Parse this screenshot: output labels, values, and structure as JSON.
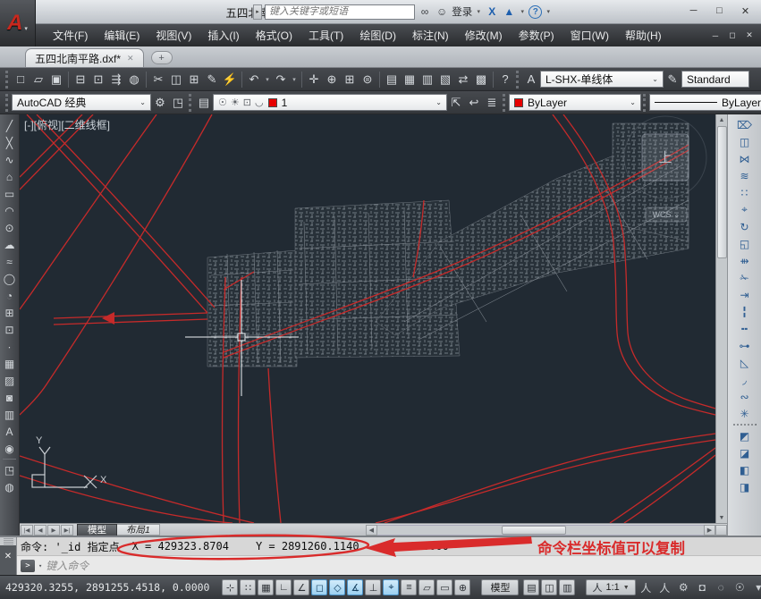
{
  "titlebar": {
    "title": "五四北南平路.dxf",
    "search_placeholder": "键入关键字或短语",
    "signin_label": "登录",
    "logo_letter": "A",
    "icons": [
      {
        "name": "search-icon",
        "glyph": "∞"
      },
      {
        "name": "user-icon",
        "glyph": "☺"
      }
    ],
    "right_icons": [
      {
        "name": "signin-dropdown-icon",
        "glyph": "▾"
      },
      {
        "name": "autodesk360-icon",
        "glyph": "X"
      },
      {
        "name": "exchange-apps-icon",
        "glyph": "▲"
      },
      {
        "name": "exchange-dropdown-icon",
        "glyph": "▾"
      }
    ],
    "help_glyph": "?",
    "help_dropdown_glyph": "▾",
    "controls": [
      {
        "name": "minimize-button",
        "glyph": "─"
      },
      {
        "name": "maximize-button",
        "glyph": "□"
      },
      {
        "name": "close-button",
        "glyph": "✕"
      }
    ]
  },
  "menubar": {
    "items": [
      {
        "name": "menu-file",
        "label": "文件(F)"
      },
      {
        "name": "menu-edit",
        "label": "编辑(E)"
      },
      {
        "name": "menu-view",
        "label": "视图(V)"
      },
      {
        "name": "menu-insert",
        "label": "插入(I)"
      },
      {
        "name": "menu-format",
        "label": "格式(O)"
      },
      {
        "name": "menu-tools",
        "label": "工具(T)"
      },
      {
        "name": "menu-draw",
        "label": "绘图(D)"
      },
      {
        "name": "menu-dimension",
        "label": "标注(N)"
      },
      {
        "name": "menu-modify",
        "label": "修改(M)"
      },
      {
        "name": "menu-parametric",
        "label": "参数(P)"
      },
      {
        "name": "menu-window",
        "label": "窗口(W)"
      },
      {
        "name": "menu-help",
        "label": "帮助(H)"
      }
    ],
    "controls": [
      {
        "name": "doc-minimize-button",
        "glyph": "─"
      },
      {
        "name": "doc-restore-button",
        "glyph": "◻"
      },
      {
        "name": "doc-close-button",
        "glyph": "✕"
      }
    ]
  },
  "tabbar": {
    "active_tab": "五四北南平路.dxf*",
    "close_glyph": "✕",
    "new_tab_glyph": "+"
  },
  "toolbar_std": {
    "icons": [
      {
        "name": "qnew-icon",
        "glyph": "□"
      },
      {
        "name": "open-icon",
        "glyph": "▱"
      },
      {
        "name": "save-icon",
        "glyph": "▣"
      },
      {
        "sep": true
      },
      {
        "name": "plot-icon",
        "glyph": "⊟"
      },
      {
        "name": "plot-preview-icon",
        "glyph": "⊡"
      },
      {
        "name": "publish-icon",
        "glyph": "⇶"
      },
      {
        "name": "export-dwf-icon",
        "glyph": "◍"
      },
      {
        "sep": true
      },
      {
        "name": "cut-icon",
        "glyph": "✂"
      },
      {
        "name": "copy-clip-icon",
        "glyph": "◫"
      },
      {
        "name": "paste-icon",
        "glyph": "⊞"
      },
      {
        "name": "match-properties-icon",
        "glyph": "✎"
      },
      {
        "name": "block-editor-icon",
        "glyph": "⚡"
      },
      {
        "sep": true
      },
      {
        "name": "undo-icon",
        "glyph": "↶"
      },
      {
        "name": "undo-dropdown-icon",
        "glyph": "▾",
        "small": true
      },
      {
        "name": "redo-icon",
        "glyph": "↷"
      },
      {
        "name": "redo-dropdown-icon",
        "glyph": "▾",
        "small": true
      },
      {
        "sep": true
      },
      {
        "name": "pan-icon",
        "glyph": "✛"
      },
      {
        "name": "zoom-realtime-icon",
        "glyph": "⊕"
      },
      {
        "name": "zoom-window-icon",
        "glyph": "⊞"
      },
      {
        "name": "zoom-previous-icon",
        "glyph": "⊜"
      },
      {
        "sep": true
      },
      {
        "name": "properties-icon",
        "glyph": "▤"
      },
      {
        "name": "designcenter-icon",
        "glyph": "▦"
      },
      {
        "name": "tool-palettes-icon",
        "glyph": "▥"
      },
      {
        "name": "sheet-set-manager-icon",
        "glyph": "▧"
      },
      {
        "name": "markup-set-manager-icon",
        "glyph": "⇄"
      },
      {
        "name": "quickcalc-icon",
        "glyph": "▩"
      },
      {
        "sep": true
      },
      {
        "name": "help-icon",
        "glyph": "?"
      }
    ]
  },
  "toolbar_styles": {
    "text_style_icon": "A",
    "text_style_value": "L-SHX-单线体",
    "dim_style_icon": "✎",
    "dim_style_value": "Standard",
    "caret": "⌄"
  },
  "toolbar_workspace": {
    "value": "AutoCAD 经典",
    "caret": "⌄",
    "icons": [
      {
        "name": "workspace-settings-icon",
        "glyph": "⚙"
      },
      {
        "name": "workspace-save-icon",
        "glyph": "◳"
      }
    ]
  },
  "toolbar_layers": {
    "layer_properties_icon": {
      "name": "layer-properties-icon",
      "glyph": "▤"
    },
    "state_icons": [
      {
        "name": "layer-on-bulb-icon",
        "glyph": "☉"
      },
      {
        "name": "layer-freeze-sun-icon",
        "glyph": "☀"
      },
      {
        "name": "layer-plot-icon",
        "glyph": "⊡"
      },
      {
        "name": "layer-unlock-icon",
        "glyph": "◡"
      }
    ],
    "current_layer": "1",
    "layer_swatch_color": "#e60000",
    "tool_icons": [
      {
        "name": "make-object-layer-current-icon",
        "glyph": "⇱"
      },
      {
        "name": "layer-previous-icon",
        "glyph": "↩"
      },
      {
        "name": "layer-states-icon",
        "glyph": "≣"
      }
    ],
    "color_value": "ByLayer",
    "linetype_value": "ByLayer",
    "caret": "⌄"
  },
  "draw_toolbar": {
    "icons": [
      {
        "name": "line-icon",
        "glyph": "╱"
      },
      {
        "name": "construction-line-icon",
        "glyph": "╳"
      },
      {
        "name": "polyline-icon",
        "glyph": "∿"
      },
      {
        "name": "polygon-icon",
        "glyph": "⌂"
      },
      {
        "name": "rectangle-icon",
        "glyph": "▭"
      },
      {
        "name": "arc-icon",
        "glyph": "◠"
      },
      {
        "name": "circle-icon",
        "glyph": "⊙"
      },
      {
        "name": "revision-cloud-icon",
        "glyph": "☁"
      },
      {
        "name": "spline-icon",
        "glyph": "≈"
      },
      {
        "name": "ellipse-icon",
        "glyph": "◯"
      },
      {
        "name": "ellipse-arc-icon",
        "glyph": "◔"
      },
      {
        "name": "insert-block-icon",
        "glyph": "⊞"
      },
      {
        "name": "create-block-icon",
        "glyph": "⊡"
      },
      {
        "name": "point-icon",
        "glyph": "∙"
      },
      {
        "name": "hatch-icon",
        "glyph": "▦"
      },
      {
        "name": "gradient-icon",
        "glyph": "▨"
      },
      {
        "name": "region-icon",
        "glyph": "◙"
      },
      {
        "name": "table-icon",
        "glyph": "▥"
      },
      {
        "name": "mtext-icon",
        "glyph": "A"
      },
      {
        "name": "add-selected-icon",
        "glyph": "◉"
      },
      {
        "sep": true
      },
      {
        "name": "viewports-icon",
        "glyph": "◳"
      },
      {
        "name": "navigation-sphere-icon",
        "glyph": "◍"
      }
    ]
  },
  "modify_toolbar": {
    "icons": [
      {
        "name": "erase-icon",
        "glyph": "⌦"
      },
      {
        "name": "copy-icon",
        "glyph": "◫"
      },
      {
        "name": "mirror-icon",
        "glyph": "⋈"
      },
      {
        "name": "offset-icon",
        "glyph": "≋"
      },
      {
        "name": "array-icon",
        "glyph": "∷"
      },
      {
        "name": "move-icon",
        "glyph": "⌖"
      },
      {
        "name": "rotate-icon",
        "glyph": "↻"
      },
      {
        "name": "scale-icon",
        "glyph": "◱"
      },
      {
        "name": "stretch-icon",
        "glyph": "⇻"
      },
      {
        "name": "trim-icon",
        "glyph": "✁"
      },
      {
        "name": "extend-icon",
        "glyph": "⇥"
      },
      {
        "name": "break-at-point-icon",
        "glyph": "╏"
      },
      {
        "name": "break-icon",
        "glyph": "╍"
      },
      {
        "name": "join-icon",
        "glyph": "⊶"
      },
      {
        "name": "chamfer-icon",
        "glyph": "◺"
      },
      {
        "name": "fillet-icon",
        "glyph": "◞"
      },
      {
        "name": "blend-curves-icon",
        "glyph": "∾"
      },
      {
        "name": "explode-icon",
        "glyph": "✳"
      },
      {
        "sep": true
      },
      {
        "name": "draworder-front-icon",
        "glyph": "◩"
      },
      {
        "name": "draworder-back-icon",
        "glyph": "◪"
      },
      {
        "name": "draworder-above-icon",
        "glyph": "◧"
      },
      {
        "name": "draworder-under-icon",
        "glyph": "◨"
      }
    ]
  },
  "canvas": {
    "viewport_label": "[-][俯视][二维线框]",
    "viewcube_top_label": "上",
    "wcs_label": "WCS ⌄",
    "ucs_x_label": "X",
    "ucs_y_label": "Y",
    "background_color": "#212a33",
    "road_color": "#c62a2a",
    "map_color": "#9aa2aa"
  },
  "layout_bar": {
    "nav": [
      {
        "name": "first-tab-button",
        "glyph": "|◀"
      },
      {
        "name": "prev-tab-button",
        "glyph": "◀"
      },
      {
        "name": "next-tab-button",
        "glyph": "▶"
      },
      {
        "name": "last-tab-button",
        "glyph": "▶|"
      }
    ],
    "model_tab": "模型",
    "layout1_tab": "布局1",
    "scroll_left_glyph": "◀",
    "scroll_right_glyph": "▶"
  },
  "command": {
    "prompt_history": "命令: '_id 指定点",
    "coord_x": "X = 429323.8704",
    "coord_y": "Y = 2891260.1140",
    "coord_z": "Z = 0.0000",
    "input_placeholder": "键入命令",
    "prompt_glyph": ">",
    "prompt_caret": "▾",
    "close_glyph": "✕",
    "annotation_label": "命令栏坐标值可以复制",
    "annotation_color": "#d92b2b"
  },
  "statusbar": {
    "coords": "429320.3255, 2891255.4518, 0.0000",
    "toggles": [
      {
        "name": "infer-constraints-toggle",
        "glyph": "⊹"
      },
      {
        "name": "snap-mode-toggle",
        "glyph": "∷"
      },
      {
        "name": "grid-display-toggle",
        "glyph": "▦"
      },
      {
        "name": "ortho-toggle",
        "glyph": "∟"
      },
      {
        "name": "polar-tracking-toggle",
        "glyph": "∠"
      },
      {
        "name": "object-snap-toggle",
        "glyph": "◻",
        "active": true
      },
      {
        "name": "object-snap-3d-toggle",
        "glyph": "◇",
        "active": true
      },
      {
        "name": "object-snap-tracking-toggle",
        "glyph": "∡",
        "active": true
      },
      {
        "name": "dynamic-ucs-toggle",
        "glyph": "⊥"
      },
      {
        "name": "dynamic-input-toggle",
        "glyph": "⌖",
        "active": true
      },
      {
        "name": "lineweight-toggle",
        "glyph": "≡"
      },
      {
        "name": "transparency-toggle",
        "glyph": "▱"
      },
      {
        "name": "quick-properties-toggle",
        "glyph": "▭"
      },
      {
        "name": "selection-cycling-toggle",
        "glyph": "⊕"
      }
    ],
    "model_button_label": "模型",
    "mid_icons": [
      {
        "name": "layout-button",
        "glyph": "▤"
      },
      {
        "name": "quick-view-layouts-button",
        "glyph": "◫"
      },
      {
        "name": "quick-view-drawings-button",
        "glyph": "▥"
      }
    ],
    "scale_person_glyph": "人",
    "scale_label": "1:1",
    "scale_caret": "▼",
    "right_icons": [
      {
        "name": "annotation-visibility-icon",
        "glyph": "人"
      },
      {
        "name": "annotation-autoscale-icon",
        "glyph": "人"
      },
      {
        "name": "workspace-switch-gear-icon",
        "glyph": "⚙"
      },
      {
        "name": "toolbar-lock-icon",
        "glyph": "◘"
      },
      {
        "name": "status-tray-icon",
        "glyph": "◌"
      },
      {
        "name": "hardware-accel-bulb-icon",
        "glyph": "☉"
      },
      {
        "name": "status-dropdown-icon",
        "glyph": "▾"
      },
      {
        "name": "clean-screen-button",
        "glyph": "▭"
      },
      {
        "name": "resize-grip",
        "glyph": "⠿"
      }
    ]
  }
}
